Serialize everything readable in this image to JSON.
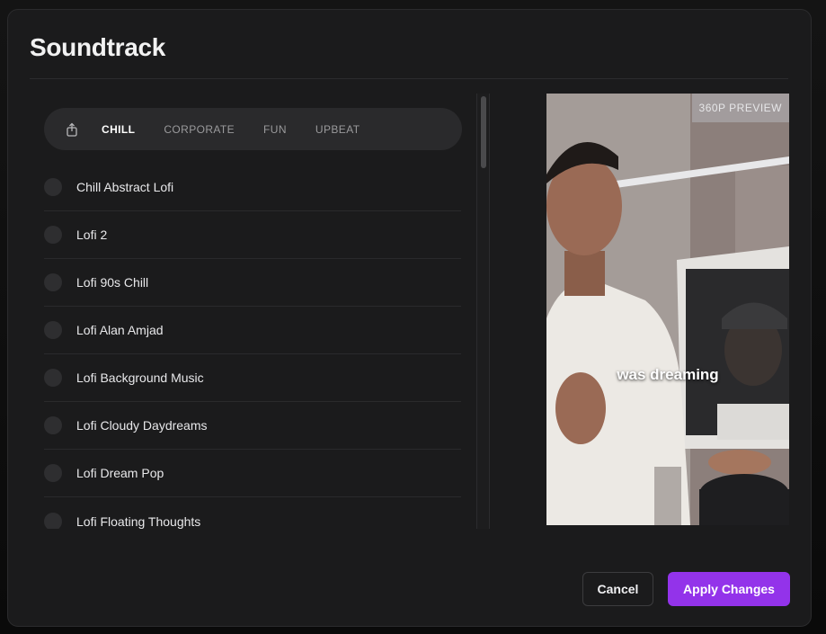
{
  "modal": {
    "title": "Soundtrack"
  },
  "categories": {
    "icon": "share-upload-icon",
    "tabs": [
      {
        "label": "CHILL",
        "active": true
      },
      {
        "label": "CORPORATE",
        "active": false
      },
      {
        "label": "FUN",
        "active": false
      },
      {
        "label": "UPBEAT",
        "active": false
      }
    ]
  },
  "tracks": [
    "Chill Abstract Lofi",
    "Lofi 2",
    "Lofi 90s Chill",
    "Lofi Alan Amjad",
    "Lofi Background Music",
    "Lofi Cloudy Daydreams",
    "Lofi Dream Pop",
    "Lofi Floating Thoughts"
  ],
  "preview": {
    "badge": "360P PREVIEW",
    "caption": "was dreaming"
  },
  "footer": {
    "cancel_label": "Cancel",
    "apply_label": "Apply Changes"
  },
  "colors": {
    "accent": "#9333ea",
    "modal_bg": "#1b1b1c"
  }
}
